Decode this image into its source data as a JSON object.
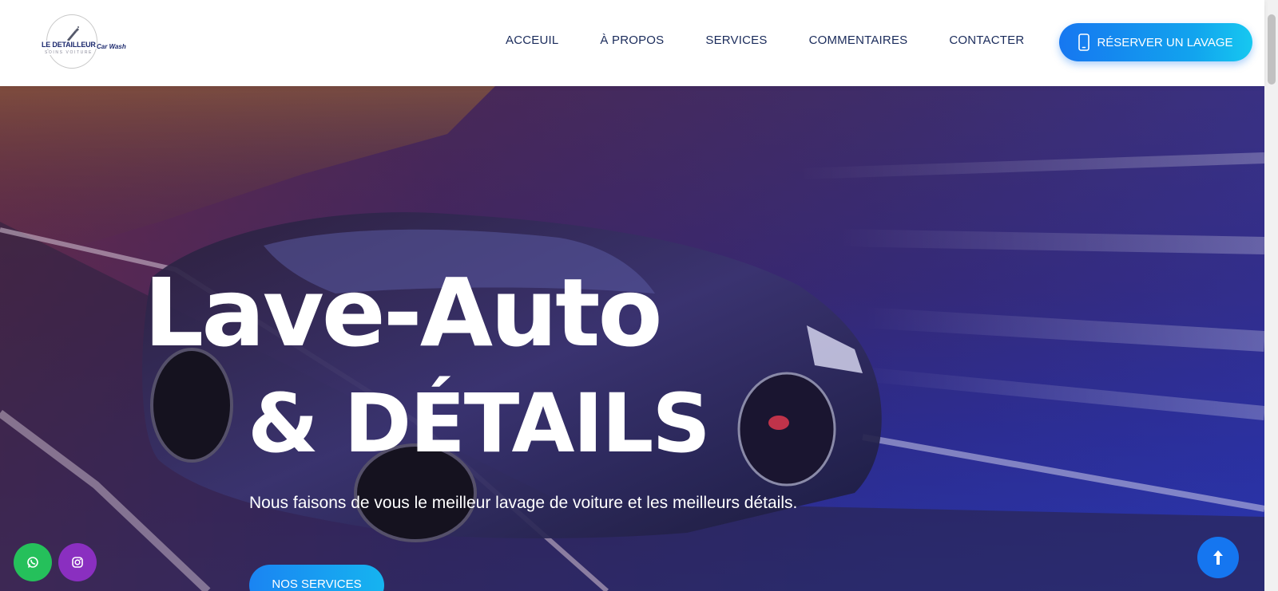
{
  "logo": {
    "brand": "LE DETAILLEUR",
    "brand_suffix": "Car Wash",
    "tagline": "SOINS VOITURE"
  },
  "nav": {
    "items": [
      {
        "label": "ACCEUIL"
      },
      {
        "label": "À PROPOS"
      },
      {
        "label": "SERVICES"
      },
      {
        "label": "COMMENTAIRES"
      },
      {
        "label": "CONTACTER"
      }
    ]
  },
  "cta": {
    "label": "RÉSERVER UN LAVAGE",
    "icon": "mobile-phone-icon"
  },
  "hero": {
    "title_line1": "Lave-Auto",
    "title_line2": "& DÉTAILS",
    "subtitle": "Nous faisons de vous le meilleur lavage de voiture et les meilleurs détails.",
    "button_label": "NOS SERVICES"
  },
  "floating": {
    "whatsapp_icon": "whatsapp-icon",
    "instagram_icon": "instagram-icon",
    "scroll_top_icon": "arrow-up-icon"
  },
  "colors": {
    "primary": "#1677f0",
    "accent": "#16c8f0",
    "nav_text": "#1a2b5b",
    "whatsapp": "#25c05b",
    "instagram": "#8a2fc0"
  }
}
